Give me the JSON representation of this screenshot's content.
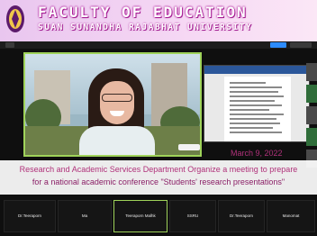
{
  "banner": {
    "faculty_title": "FACULTY OF EDUCATION",
    "university_title": "SUAN SUNANDHA RAJABHAT UNIVERSITY",
    "accent_color": "#b1249d"
  },
  "meeting": {
    "speaker_highlight_color": "#9fd35a",
    "shared_window": "document-window"
  },
  "caption": {
    "date": "March 9, 2022",
    "line1": "Research and Academic Services Department Organize a meeting to prepare",
    "line2": "for a national academic conference \"Students' research presentations\"",
    "color": "#b0317a"
  },
  "participants": [
    {
      "name": "Dr.Teeraporn",
      "active": false
    },
    {
      "name": "Ma",
      "active": false
    },
    {
      "name": "Teeraporn Malhk",
      "active": true
    },
    {
      "name": "SSRU",
      "active": false
    },
    {
      "name": "Dr.Teeraporn",
      "active": false
    },
    {
      "name": "Manomat",
      "active": false
    }
  ]
}
